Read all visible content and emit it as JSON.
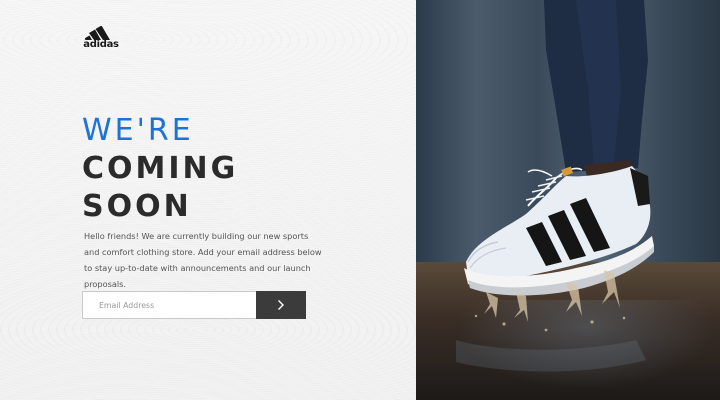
{
  "brand": {
    "name": "adidas",
    "logo_icon": "adidas-three-stripes-icon"
  },
  "headline": {
    "line1": "WE'RE",
    "line2": "COMING",
    "line3": "SOON"
  },
  "intro": {
    "text": "Hello friends! We are currently building our new sports and comfort clothing store. Add your email address below to stay up-to-date with announcements and our launch proposals."
  },
  "signup": {
    "placeholder": "Email Address",
    "submit_icon": "chevron-right-icon"
  },
  "hero_image": {
    "description_icon": "sneaker-splash-photo"
  },
  "colors": {
    "accent": "#1c73d6",
    "button": "#3b3b3b",
    "text_dark": "#2b2b2b"
  }
}
